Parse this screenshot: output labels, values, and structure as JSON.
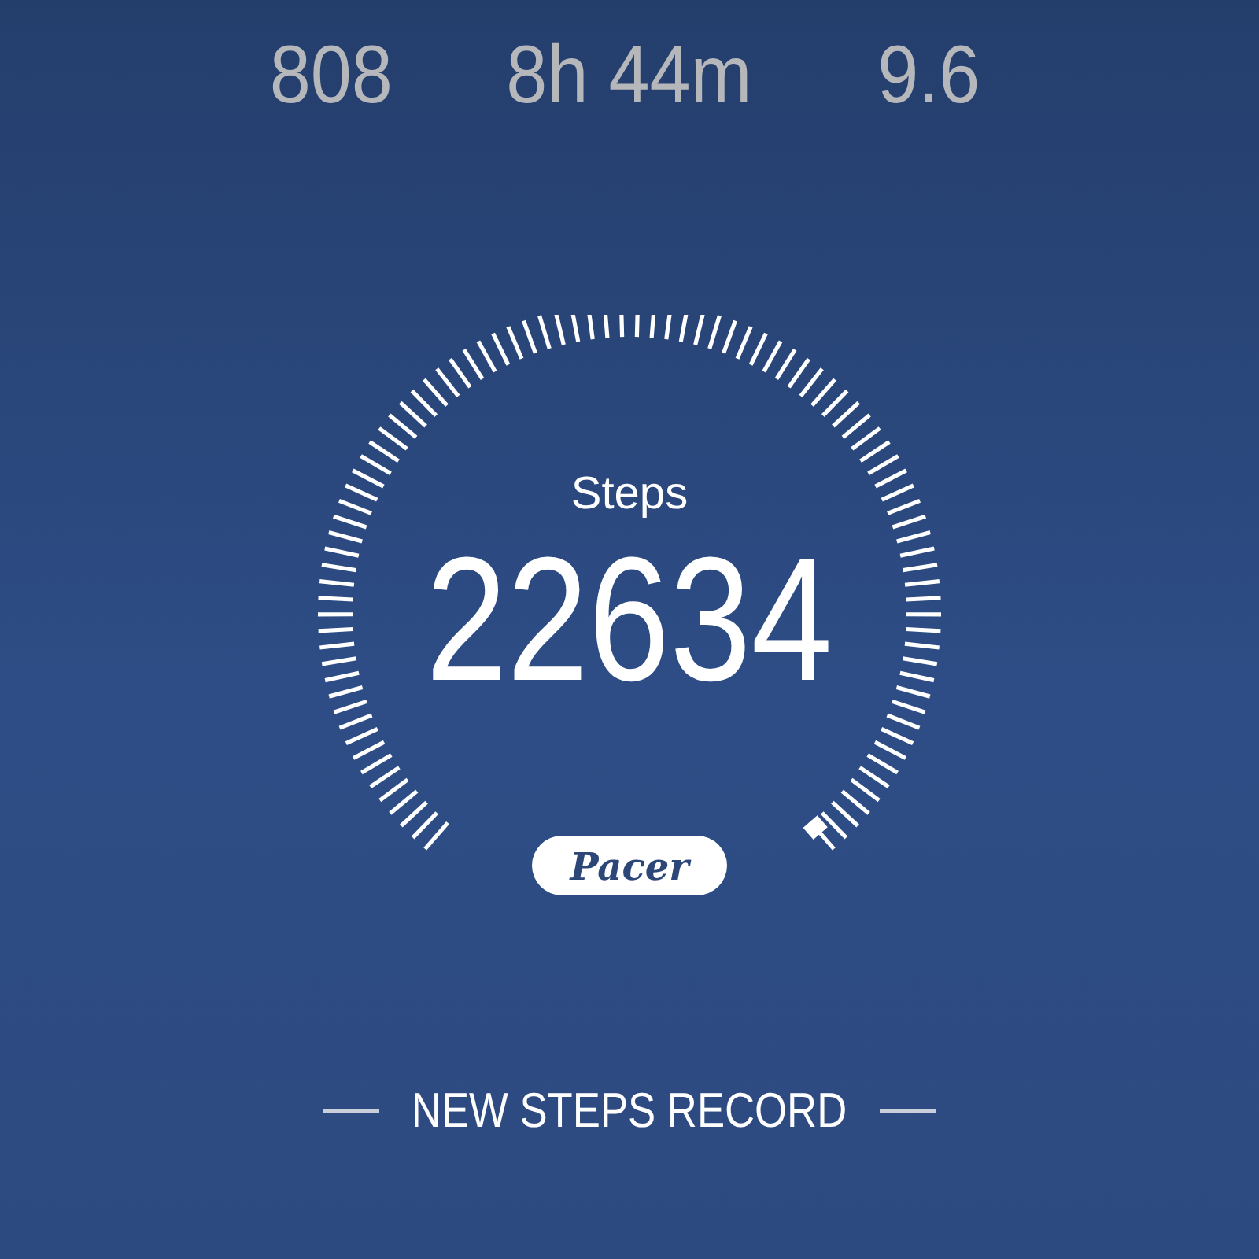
{
  "stats": [
    {
      "value": "808"
    },
    {
      "value": "8h 44m"
    },
    {
      "value": "9.6"
    }
  ],
  "gauge": {
    "label": "Steps",
    "value": "22634"
  },
  "brand": "Pacer",
  "banner": "NEW STEPS RECORD"
}
